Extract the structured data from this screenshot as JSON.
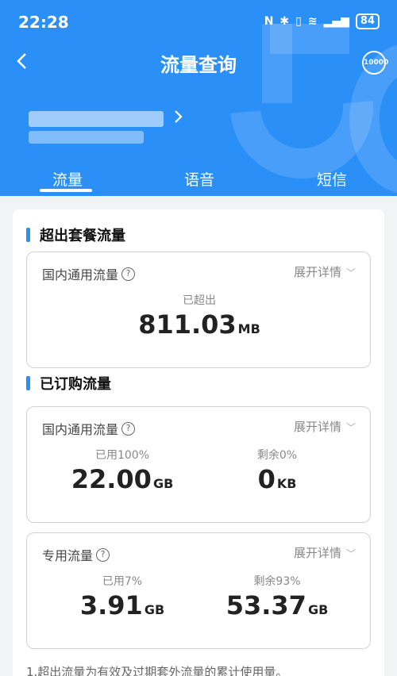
{
  "status": {
    "time": "22:28",
    "battery": "84",
    "icons": [
      "nfc-icon",
      "bluetooth-icon",
      "vibrate-icon",
      "wifi-icon",
      "signal-icon"
    ]
  },
  "header": {
    "title": "流量查询",
    "back_icon": "back-arrow-icon",
    "service_badge": "10000",
    "accent": "#2a8ff7"
  },
  "tabs": [
    {
      "label": "流量",
      "active": true
    },
    {
      "label": "语音"
    },
    {
      "label": "短信"
    }
  ],
  "overage": {
    "title": "超出套餐流量",
    "box": {
      "label": "国内通用流量",
      "help": "?",
      "expand": "展开详情",
      "caption": "已超出",
      "value": "811.03",
      "unit": "MB"
    }
  },
  "subscribed": {
    "title": "已订购流量",
    "boxes": [
      {
        "label": "国内通用流量",
        "help": "?",
        "expand": "展开详情",
        "used_caption": "已用100%",
        "used_value": "22.00",
        "used_unit": "GB",
        "remain_caption": "剩余0%",
        "remain_value": "0",
        "remain_unit": "KB"
      },
      {
        "label": "专用流量",
        "help": "?",
        "expand": "展开详情",
        "used_caption": "已用7%",
        "used_value": "3.91",
        "used_unit": "GB",
        "remain_caption": "剩余93%",
        "remain_value": "53.37",
        "remain_unit": "GB"
      }
    ]
  },
  "footnote": "1.超出流量为有效及过期套外流量的累计使用量。"
}
